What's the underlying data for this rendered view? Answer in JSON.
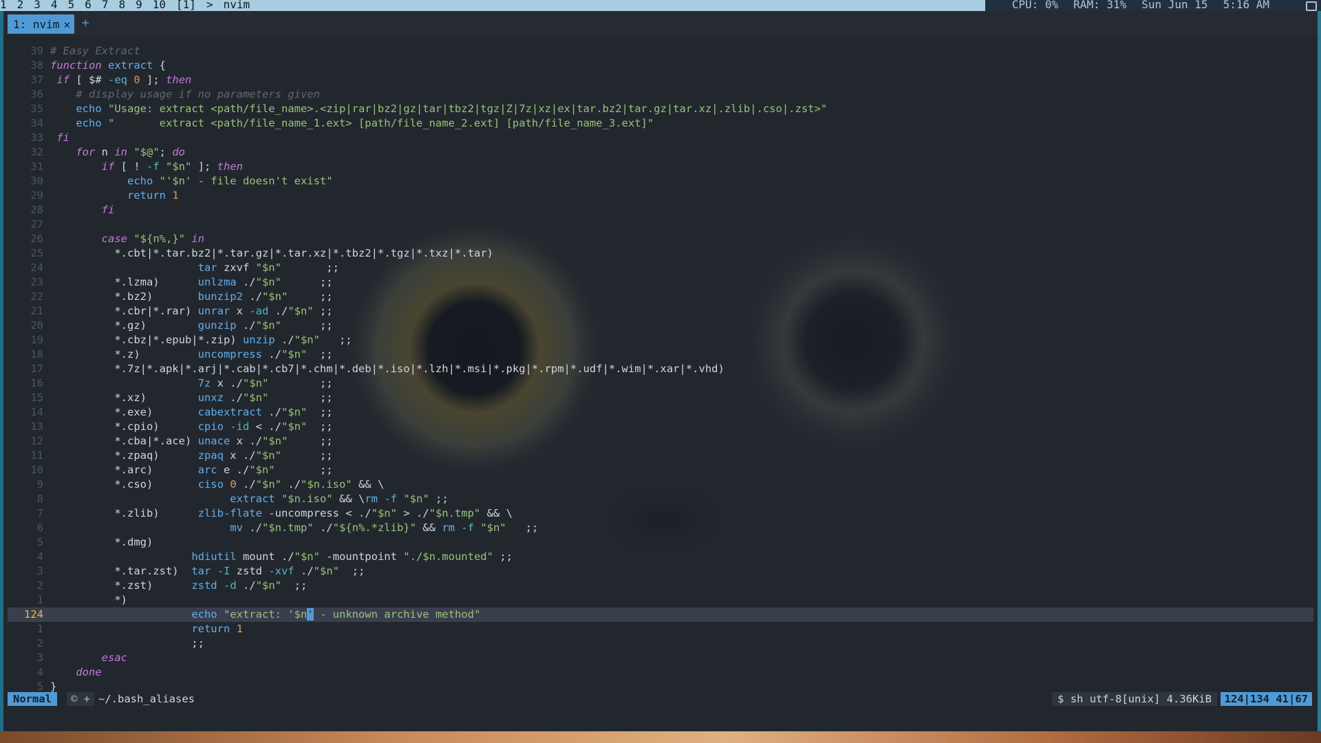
{
  "topbar": {
    "workspaces": [
      "1",
      "2",
      "3",
      "4",
      "5",
      "6",
      "7",
      "8",
      "9",
      "10",
      "[1]",
      ">",
      "nvim"
    ],
    "cpu": "CPU: 0%",
    "ram": "RAM: 31%",
    "date": "Sun Jun 15",
    "time": "5:16 AM"
  },
  "terminal": {
    "tab_label": "1: nvim",
    "tab_close": "✕",
    "new_tab": "+"
  },
  "editor": {
    "lines": [
      {
        "n": "39",
        "html": "<span class=\"cm\"># Easy Extract</span>"
      },
      {
        "n": "38",
        "html": "<span class=\"kw\">function</span> <span class=\"fn\">extract</span> {"
      },
      {
        "n": "37",
        "html": " <span class=\"kw\">if</span> [ $# <span class=\"op\">-eq</span> <span class=\"nu\">0</span> ]; <span class=\"kw\">then</span>"
      },
      {
        "n": "36",
        "html": "    <span class=\"cm\"># display usage if no parameters given</span>"
      },
      {
        "n": "35",
        "html": "    <span class=\"fn\">echo</span> <span class=\"st\">\"Usage: extract &lt;path/file_name&gt;.&lt;zip|rar|bz2|gz|tar|tbz2|tgz|Z|7z|xz|ex|tar.bz2|tar.gz|tar.xz|.zlib|.cso|.zst&gt;\"</span>"
      },
      {
        "n": "34",
        "html": "    <span class=\"fn\">echo</span> <span class=\"st\">\"       extract &lt;path/file_name_1.ext&gt; [path/file_name_2.ext] [path/file_name_3.ext]\"</span>"
      },
      {
        "n": "33",
        "html": " <span class=\"kw\">fi</span>"
      },
      {
        "n": "32",
        "html": "    <span class=\"kw\">for</span> n <span class=\"kw\">in</span> <span class=\"st\">\"$@\"</span>; <span class=\"kw\">do</span>"
      },
      {
        "n": "31",
        "html": "        <span class=\"kw\">if</span> [ ! <span class=\"op\">-f</span> <span class=\"st\">\"$n\"</span> ]; <span class=\"kw\">then</span>"
      },
      {
        "n": "30",
        "html": "            <span class=\"fn\">echo</span> <span class=\"st\">\"'$n' - file doesn't exist\"</span>"
      },
      {
        "n": "29",
        "html": "            <span class=\"fn\">return</span> <span class=\"nu\">1</span>"
      },
      {
        "n": "28",
        "html": "        <span class=\"kw\">fi</span>"
      },
      {
        "n": "27",
        "html": ""
      },
      {
        "n": "26",
        "html": "        <span class=\"kw\">case</span> <span class=\"st\">\"${n%,}\"</span> <span class=\"kw\">in</span>"
      },
      {
        "n": "25",
        "html": "          *.cbt|*.tar.bz2|*.tar.gz|*.tar.xz|*.tbz2|*.tgz|*.txz|*.tar)"
      },
      {
        "n": "24",
        "html": "                       <span class=\"fn\">tar</span> zxvf <span class=\"st\">\"$n\"</span>       ;;"
      },
      {
        "n": "23",
        "html": "          *.lzma)      <span class=\"fn\">unlzma</span> ./<span class=\"st\">\"$n\"</span>      ;;"
      },
      {
        "n": "22",
        "html": "          *.bz2)       <span class=\"fn\">bunzip2</span> ./<span class=\"st\">\"$n\"</span>     ;;"
      },
      {
        "n": "21",
        "html": "          *.cbr|*.rar) <span class=\"fn\">unrar</span> x <span class=\"op\">-ad</span> ./<span class=\"st\">\"$n\"</span> ;;"
      },
      {
        "n": "20",
        "html": "          *.gz)        <span class=\"fn\">gunzip</span> ./<span class=\"st\">\"$n\"</span>      ;;"
      },
      {
        "n": "19",
        "html": "          *.cbz|*.epub|*.zip) <span class=\"fn\">unzip</span> ./<span class=\"st\">\"$n\"</span>   ;;"
      },
      {
        "n": "18",
        "html": "          *.z)         <span class=\"fn\">uncompress</span> ./<span class=\"st\">\"$n\"</span>  ;;"
      },
      {
        "n": "17",
        "html": "          *.7z|*.apk|*.arj|*.cab|*.cb7|*.chm|*.deb|*.iso|*.lzh|*.msi|*.pkg|*.rpm|*.udf|*.wim|*.xar|*.vhd)"
      },
      {
        "n": "16",
        "html": "                       <span class=\"fn\">7z</span> x ./<span class=\"st\">\"$n\"</span>        ;;"
      },
      {
        "n": "15",
        "html": "          *.xz)        <span class=\"fn\">unxz</span> ./<span class=\"st\">\"$n\"</span>        ;;"
      },
      {
        "n": "14",
        "html": "          *.exe)       <span class=\"fn\">cabextract</span> ./<span class=\"st\">\"$n\"</span>  ;;"
      },
      {
        "n": "13",
        "html": "          *.cpio)      <span class=\"fn\">cpio</span> <span class=\"op\">-id</span> &lt; ./<span class=\"st\">\"$n\"</span>  ;;"
      },
      {
        "n": "12",
        "html": "          *.cba|*.ace) <span class=\"fn\">unace</span> x ./<span class=\"st\">\"$n\"</span>     ;;"
      },
      {
        "n": "11",
        "html": "          *.zpaq)      <span class=\"fn\">zpaq</span> x ./<span class=\"st\">\"$n\"</span>      ;;"
      },
      {
        "n": "10",
        "html": "          *.arc)       <span class=\"fn\">arc</span> e ./<span class=\"st\">\"$n\"</span>       ;;"
      },
      {
        "n": "9",
        "html": "          *.cso)       <span class=\"fn\">ciso</span> <span class=\"nu\">0</span> ./<span class=\"st\">\"$n\"</span> ./<span class=\"st\">\"$n.iso\"</span> &amp;&amp; \\"
      },
      {
        "n": "8",
        "html": "                            <span class=\"fn\">extract</span> <span class=\"st\">\"$n.iso\"</span> &amp;&amp; \\<span class=\"fn\">rm</span> <span class=\"op\">-f</span> <span class=\"st\">\"$n\"</span> ;;"
      },
      {
        "n": "7",
        "html": "          *.zlib)      <span class=\"fn\">zlib-flate</span> -uncompress &lt; ./<span class=\"st\">\"$n\"</span> &gt; ./<span class=\"st\">\"$n.tmp\"</span> &amp;&amp; \\"
      },
      {
        "n": "6",
        "html": "                            <span class=\"fn\">mv</span> ./<span class=\"st\">\"$n.tmp\"</span> ./<span class=\"st\">\"${n%.*zlib}\"</span> &amp;&amp; <span class=\"fn\">rm</span> <span class=\"op\">-f</span> <span class=\"st\">\"$n\"</span>   ;;"
      },
      {
        "n": "5",
        "html": "          *.dmg)"
      },
      {
        "n": "4",
        "html": "                      <span class=\"fn\">hdiutil</span> mount ./<span class=\"st\">\"$n\"</span> -mountpoint <span class=\"st\">\"./$n.mounted\"</span> ;;"
      },
      {
        "n": "3",
        "html": "          *.tar.zst)  <span class=\"fn\">tar</span> <span class=\"op\">-I</span> zstd <span class=\"op\">-xvf</span> ./<span class=\"st\">\"$n\"</span>  ;;"
      },
      {
        "n": "2",
        "html": "          *.zst)      <span class=\"fn\">zstd</span> <span class=\"op\">-d</span> ./<span class=\"st\">\"$n\"</span>  ;;"
      },
      {
        "n": "1",
        "html": "          *)"
      },
      {
        "n": "124",
        "cur": true,
        "html": "                      <span class=\"fn\">echo</span> <span class=\"st\">\"extract: '$n<span class=\"cursor\">'</span> - unknown archive method\"</span>"
      },
      {
        "n": "1",
        "html": "                      <span class=\"fn\">return</span> <span class=\"nu\">1</span>"
      },
      {
        "n": "2",
        "html": "                      ;;"
      },
      {
        "n": "3",
        "html": "        <span class=\"kw\">esac</span>"
      },
      {
        "n": "4",
        "html": "    <span class=\"kw\">done</span>"
      },
      {
        "n": "5",
        "html": "}"
      }
    ]
  },
  "statusline": {
    "mode": "Normal",
    "flags": "© +",
    "filename": "~/.bash_aliases",
    "fileinfo": "$ sh utf-8[unix] 4.36KiB",
    "position": "124|134 41|67"
  }
}
